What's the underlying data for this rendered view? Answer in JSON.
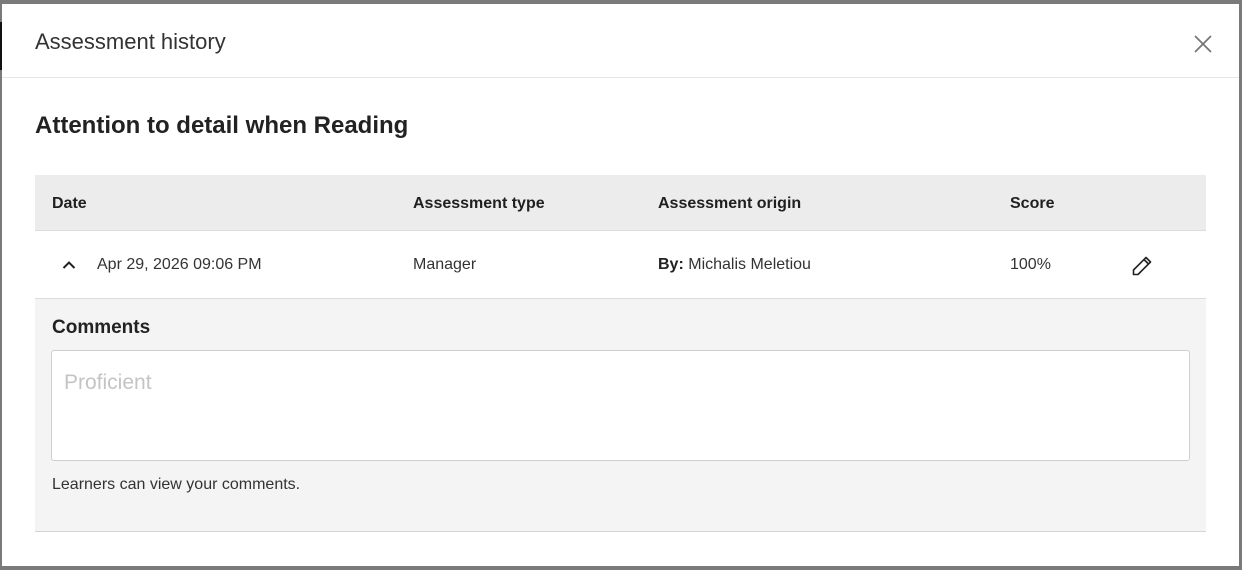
{
  "dialog": {
    "title": "Assessment history",
    "close_icon": "close-icon"
  },
  "skill": {
    "name": "Attention to detail when Reading"
  },
  "table": {
    "headers": {
      "date": "Date",
      "type": "Assessment type",
      "origin": "Assessment origin",
      "score": "Score"
    },
    "rows": [
      {
        "date": "Apr 29, 2026 09:06 PM",
        "type": "Manager",
        "origin_prefix": "By:",
        "origin_name": "Michalis Meletiou",
        "score": "100%",
        "expand_icon": "chevron-up-icon",
        "edit_icon": "pencil-icon"
      }
    ]
  },
  "comments": {
    "label": "Comments",
    "placeholder": "Proficient",
    "helper": "Learners can view your comments."
  },
  "colors": {
    "header_bg": "#ececec",
    "expanded_bg": "#f4f4f4",
    "backdrop": "#7a7a7a"
  }
}
